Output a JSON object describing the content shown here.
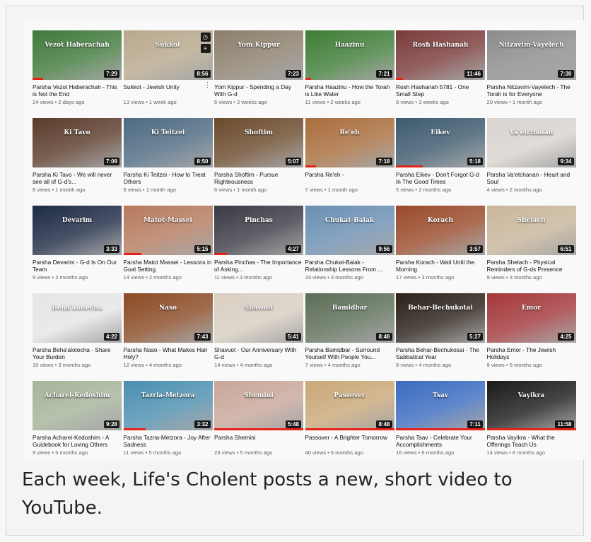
{
  "videos": [
    {
      "title": "Parsha Vezot Haberachah - This is Not the End",
      "meta": "24 views • 2 days ago",
      "thumb": "Vezot Haberachah",
      "duration": "7:29",
      "progress": 0.12,
      "color": "#3f7a3a"
    },
    {
      "title": "Sukkot - Jewish Unity",
      "meta": "13 views • 1 week ago",
      "thumb": "Sukkot",
      "duration": "8:56",
      "progress": 0,
      "color": "#b8a98d"
    },
    {
      "title": "Yom Kippur - Spending a Day With G-d",
      "meta": "5 views • 2 weeks ago",
      "thumb": "Yom Kippur",
      "duration": "7:23",
      "progress": 0,
      "color": "#8b7f6c"
    },
    {
      "title": "Parsha Haazinu - How the Torah is Like Water",
      "meta": "11 views • 2 weeks ago",
      "thumb": "Haazinu",
      "duration": "7:21",
      "progress": 0.07,
      "color": "#3e7d35"
    },
    {
      "title": "Rosh Hashanah 5781 - One Small Step",
      "meta": "8 views • 3 weeks ago",
      "thumb": "Rosh Hashanah",
      "duration": "11:46",
      "progress": 0.08,
      "color": "#7a3b3a"
    },
    {
      "title": "Parsha Nitzavim-Vayelech - The Torah is for Everyone",
      "meta": "20 views • 1 month ago",
      "thumb": "Nitzavim-Vayelech",
      "duration": "7:30",
      "progress": 0,
      "color": "#8c8c8c"
    },
    {
      "title": "Parsha Ki Tavo - We will never see all of G-d's...",
      "meta": "6 views • 1 month ago",
      "thumb": "Ki Tavo",
      "duration": "7:09",
      "progress": 0,
      "color": "#5a3b2a"
    },
    {
      "title": "Parsha Ki Teitzei - How to Treat Others",
      "meta": "6 views • 1 month ago",
      "thumb": "Ki Teitzei",
      "duration": "8:50",
      "progress": 0,
      "color": "#4d6a82"
    },
    {
      "title": "Parsha Shoftim - Pursue Righteousness",
      "meta": "6 views • 1 month ago",
      "thumb": "Shoftim",
      "duration": "5:07",
      "progress": 0,
      "color": "#6b4a2c"
    },
    {
      "title": "Parsha Re'eh -",
      "meta": "7 views • 1 month ago",
      "thumb": "Re'eh",
      "duration": "7:18",
      "progress": 0.12,
      "color": "#a96d3c"
    },
    {
      "title": "Parsha Eikev - Don't Forgot G-d In The Good Times",
      "meta": "5 views • 2 months ago",
      "thumb": "Eikev",
      "duration": "5:18",
      "progress": 0.3,
      "color": "#3c5a6e"
    },
    {
      "title": "Parsha Va'etchanan - Heart and Soul",
      "meta": "4 views • 2 months ago",
      "thumb": "Va'etchanan",
      "duration": "9:34",
      "progress": 0,
      "color": "#d9d4cf"
    },
    {
      "title": "Parsha Devarim - G-d Is On Our Team",
      "meta": "9 views • 2 months ago",
      "thumb": "Devarim",
      "duration": "3:33",
      "progress": 0,
      "color": "#1d2a44"
    },
    {
      "title": "Parsha Matot Massei - Lessons in Goal Setting",
      "meta": "14 views • 2 months ago",
      "thumb": "Matot-Massei",
      "duration": "5:15",
      "progress": 0.2,
      "color": "#b57a5d"
    },
    {
      "title": "Parsha Pinchas - The Importance of Asking...",
      "meta": "11 views • 3 months ago",
      "thumb": "Pinchas",
      "duration": "4:27",
      "progress": 0.14,
      "color": "#3a3a44"
    },
    {
      "title": "Parsha Chukat-Balak - Relationship Lessons From ...",
      "meta": "33 views • 3 months ago",
      "thumb": "Chukat-Balak",
      "duration": "9:56",
      "progress": 0,
      "color": "#6a8fb3"
    },
    {
      "title": "Parsha Korach - Wait Until the Morning",
      "meta": "17 views • 3 months ago",
      "thumb": "Korach",
      "duration": "3:57",
      "progress": 0,
      "color": "#9a4a2a"
    },
    {
      "title": "Parsha Shelach - Physical Reminders of G-ds Presence",
      "meta": "9 views • 3 months ago",
      "thumb": "Shelach",
      "duration": "6:51",
      "progress": 0,
      "color": "#c9b69a"
    },
    {
      "title": "Parsha Beha'alotecha - Share Your Burden",
      "meta": "10 views • 3 months ago",
      "thumb": "Beha'alotecha",
      "duration": "4:22",
      "progress": 0,
      "color": "#e6e6e6"
    },
    {
      "title": "Parsha Naso - What Makes Hair Holy?",
      "meta": "12 views • 4 months ago",
      "thumb": "Naso",
      "duration": "7:43",
      "progress": 0,
      "color": "#8a4a24"
    },
    {
      "title": "Shavuot - Our Anniversary With G-d",
      "meta": "14 views • 4 months ago",
      "thumb": "Shavuot",
      "duration": "5:41",
      "progress": 0,
      "color": "#d9cfc2"
    },
    {
      "title": "Parsha Bamidbar - Surround Yourself With People You...",
      "meta": "7 views • 4 months ago",
      "thumb": "Bamidbar",
      "duration": "8:48",
      "progress": 0,
      "color": "#5c6e57"
    },
    {
      "title": "Parsha Behar-Bechukosai - The Sabbatical Year",
      "meta": "8 views • 4 months ago",
      "thumb": "Behar-Bechukotai",
      "duration": "5:27",
      "progress": 0,
      "color": "#2a2018"
    },
    {
      "title": "Parsha Emor - The Jewish Holidays",
      "meta": "9 views • 5 months ago",
      "thumb": "Emor",
      "duration": "4:25",
      "progress": 0,
      "color": "#a3373a"
    },
    {
      "title": "Parsha Acharei-Kedoshim - A Guidebook for Loving Others",
      "meta": "9 views • 5 months ago",
      "thumb": "Acharei-Kedoshim",
      "duration": "9:28",
      "progress": 0,
      "color": "#a5b49a"
    },
    {
      "title": "Parsha Tazria-Metzora - Joy After Sadness",
      "meta": "11 views • 5 months ago",
      "thumb": "Tazria-Metzora",
      "duration": "3:32",
      "progress": 0.25,
      "color": "#4a8fb0"
    },
    {
      "title": "Parsha Shemini",
      "meta": "23 views • 5 months ago",
      "thumb": "Shemini",
      "duration": "5:48",
      "progress": 1,
      "color": "#c9a79a"
    },
    {
      "title": "Passover - A Brighter Tomorrow",
      "meta": "40 views • 6 months ago",
      "thumb": "Passover",
      "duration": "8:48",
      "progress": 1,
      "color": "#caa878"
    },
    {
      "title": "Parsha Tsav - Celebrate Your Accomplishments",
      "meta": "16 views • 6 months ago",
      "thumb": "Tsav",
      "duration": "7:11",
      "progress": 1,
      "color": "#3a6bc0"
    },
    {
      "title": "Parsha Vayikra - What the Offerings Teach Us",
      "meta": "14 views • 6 months ago",
      "thumb": "Vayikra",
      "duration": "11:58",
      "progress": 1,
      "color": "#1a1a1a"
    }
  ],
  "caption": "Each week, Life's Cholent posts a new, short video to YouTube."
}
